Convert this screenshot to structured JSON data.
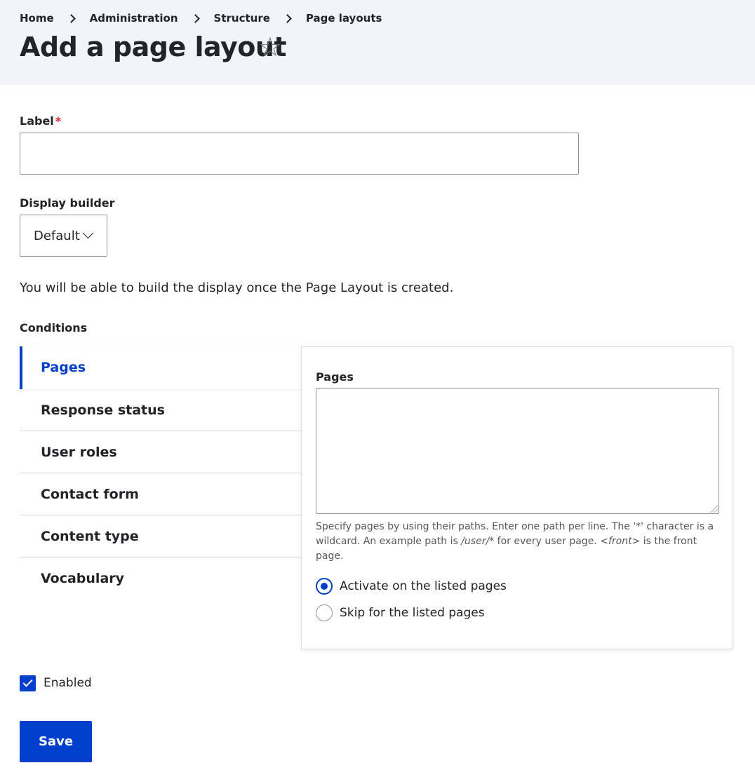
{
  "breadcrumb": {
    "items": [
      {
        "label": "Home"
      },
      {
        "label": "Administration"
      },
      {
        "label": "Structure"
      },
      {
        "label": "Page layouts"
      }
    ]
  },
  "page": {
    "title": "Add a page layout",
    "star_icon": "☆"
  },
  "form": {
    "label_field": {
      "label": "Label",
      "required_marker": "*",
      "value": ""
    },
    "display_builder": {
      "label": "Display builder",
      "selected": "Default"
    },
    "help_text": "You will be able to build the display once the Page Layout is created.",
    "conditions": {
      "label": "Conditions",
      "tabs": [
        {
          "label": "Pages",
          "active": true
        },
        {
          "label": "Response status"
        },
        {
          "label": "User roles"
        },
        {
          "label": "Contact form"
        },
        {
          "label": "Content type"
        },
        {
          "label": "Vocabulary"
        }
      ],
      "panel": {
        "label": "Pages",
        "textarea_value": "",
        "description": {
          "part1": "Specify pages by using their paths. Enter one path per line. The '*' character is a wildcard. An example path is ",
          "example_path": "/user/*",
          "part2": " for every user page. ",
          "front_token": "<front>",
          "part3": " is the front page."
        },
        "options": [
          {
            "label": "Activate on the listed pages",
            "checked": true
          },
          {
            "label": "Skip for the listed pages",
            "checked": false
          }
        ]
      }
    },
    "enabled": {
      "label": "Enabled",
      "checked": true
    },
    "save_label": "Save"
  },
  "colors": {
    "accent": "#003ecc",
    "header_bg": "#f3f4f9",
    "required": "#d72222"
  }
}
